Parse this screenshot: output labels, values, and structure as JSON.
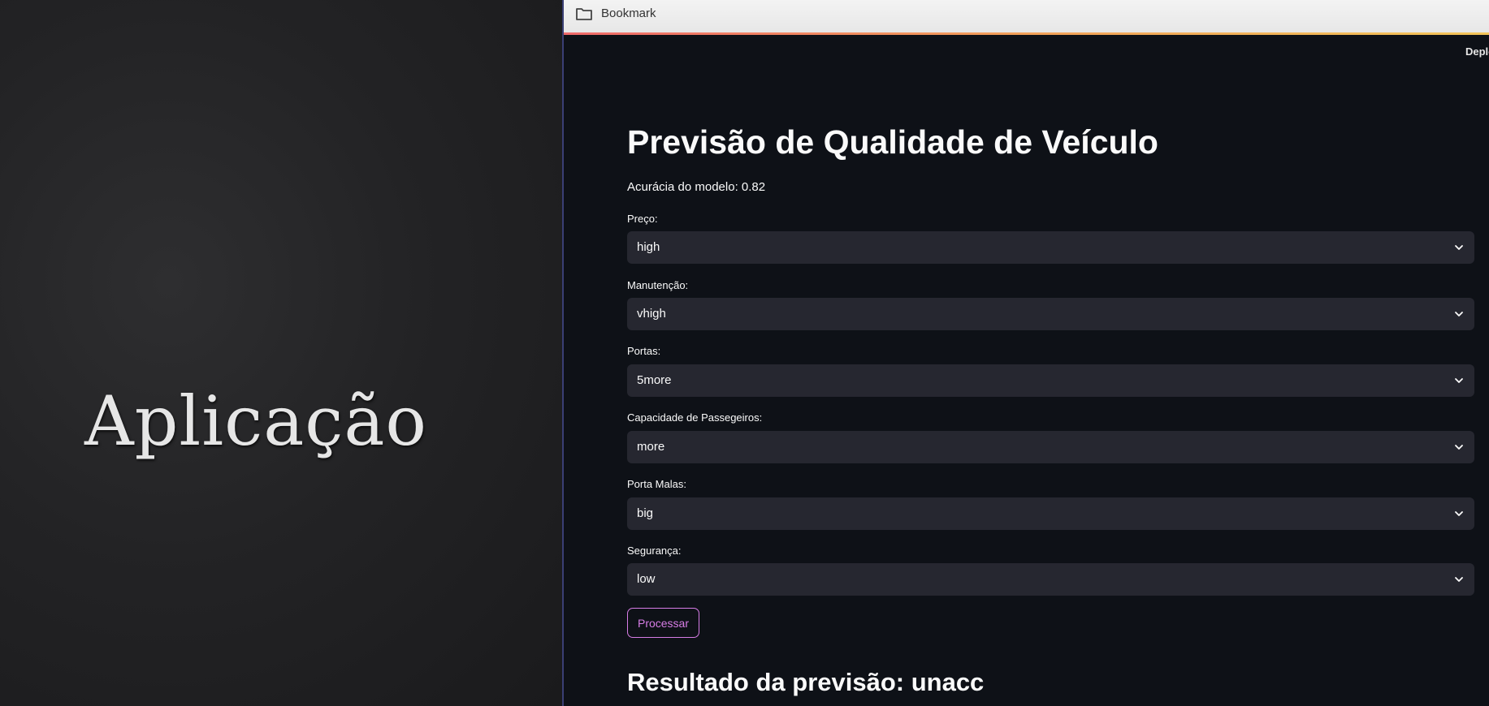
{
  "slide": {
    "title": "Aplicação"
  },
  "browser": {
    "bookmark_bar": {
      "folder_label": "Bookmark"
    },
    "deploy_label": "Deplo"
  },
  "app": {
    "title": "Previsão de Qualidade de Veículo",
    "accuracy_text": "Acurácia do modelo: 0.82",
    "fields": [
      {
        "label": "Preço:",
        "value": "high"
      },
      {
        "label": "Manutenção:",
        "value": "vhigh"
      },
      {
        "label": "Portas:",
        "value": "5more"
      },
      {
        "label": "Capacidade de Passegeiros:",
        "value": "more"
      },
      {
        "label": "Porta Malas:",
        "value": "big"
      },
      {
        "label": "Segurança:",
        "value": "low"
      }
    ],
    "process_button": "Processar",
    "result_text": "Resultado da previsão: unacc"
  },
  "colors": {
    "app_background": "#0e1117",
    "select_background": "#262730",
    "button_accent": "#d77de6"
  },
  "icons": [
    "folder-icon",
    "chevron-down-icon"
  ]
}
